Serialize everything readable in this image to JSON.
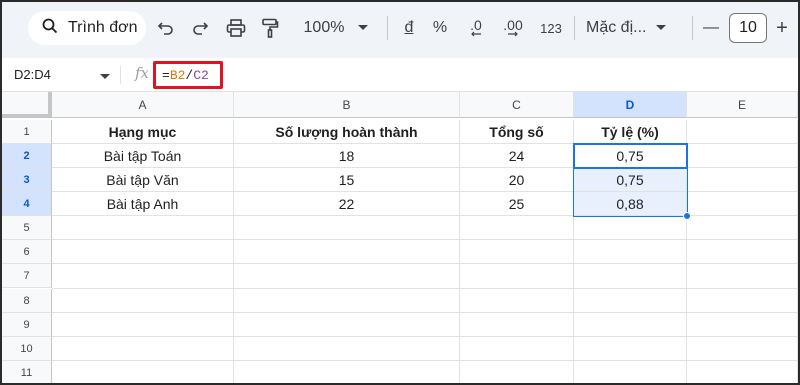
{
  "toolbar": {
    "search_label": "Trình đơn",
    "zoom": "100%",
    "currency_symbol": "đ",
    "percent_symbol": "%",
    "decrease_decimal": ".0",
    "increase_decimal": ".00",
    "number_format": "123",
    "font_name": "Mặc đị...",
    "font_size": "10",
    "minus": "—",
    "plus": "+"
  },
  "formula_bar": {
    "name_box": "D2:D4",
    "fx_label": "fx",
    "formula_eq": "=",
    "formula_ref1": "B2",
    "formula_op": "/",
    "formula_ref2": "C2"
  },
  "sheet": {
    "columns": [
      "A",
      "B",
      "C",
      "D",
      "E"
    ],
    "rows": [
      "1",
      "2",
      "3",
      "4",
      "5",
      "6",
      "7",
      "8",
      "9",
      "10",
      "11"
    ],
    "header_row": [
      "Hạng mục",
      "Số lượng hoàn thành",
      "Tổng số",
      "Tỷ lệ (%)"
    ],
    "data": [
      [
        "Bài tập Toán",
        "18",
        "24",
        "0,75"
      ],
      [
        "Bài tập Văn",
        "15",
        "20",
        "0,75"
      ],
      [
        "Bài tập Anh",
        "22",
        "25",
        "0,88"
      ]
    ],
    "selected_column": "D",
    "selected_rows": [
      "2",
      "3",
      "4"
    ]
  },
  "colors": {
    "selection": "#1a73e8",
    "formula_highlight_border": "#e0141e",
    "ref1_color": "#e37400",
    "ref2_color": "#8e44ad"
  }
}
